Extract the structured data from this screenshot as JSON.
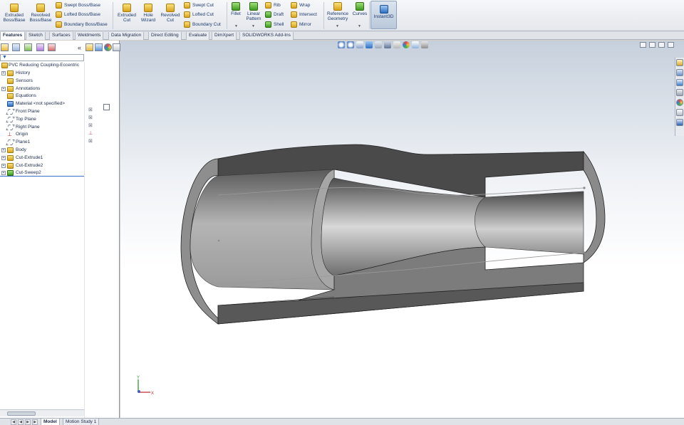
{
  "ribbon": {
    "extruded_boss": [
      "Extruded",
      "Boss/Base"
    ],
    "revolved_boss": [
      "Revolved",
      "Boss/Base"
    ],
    "swept_boss": "Swept Boss/Base",
    "lofted_boss": "Lofted Boss/Base",
    "boundary_boss": "Boundary Boss/Base",
    "extruded_cut": [
      "Extruded",
      "Cut"
    ],
    "hole_wizard": [
      "Hole",
      "Wizard"
    ],
    "revolved_cut": [
      "Revolved",
      "Cut"
    ],
    "swept_cut": "Swept Cut",
    "lofted_cut": "Lofted Cut",
    "boundary_cut": "Boundary Cut",
    "fillet": "Fillet",
    "linear_pattern": [
      "Linear",
      "Pattern"
    ],
    "rib": "Rib",
    "draft": "Draft",
    "shell": "Shell",
    "wrap": "Wrap",
    "intersect": "Intersect",
    "mirror": "Mirror",
    "reference_geometry": [
      "Reference",
      "Geometry"
    ],
    "curves": "Curves",
    "instant3d": "Instant3D"
  },
  "tabs": [
    "Features",
    "Sketch",
    "Surfaces",
    "Weldments",
    "Data Migration",
    "Direct Editing",
    "Evaluate",
    "DimXpert",
    "SOLIDWORKS Add-Ins"
  ],
  "tree": {
    "root": "PVC Reducing Coupling-Eccentric",
    "items": [
      {
        "label": "History",
        "expandable": true
      },
      {
        "label": "Sensors",
        "expandable": false
      },
      {
        "label": "Annotations",
        "expandable": true
      },
      {
        "label": "Equations",
        "expandable": false
      },
      {
        "label": "Material <not specified>",
        "expandable": false
      },
      {
        "label": "Front Plane",
        "expandable": false
      },
      {
        "label": "Top Plane",
        "expandable": false
      },
      {
        "label": "Right Plane",
        "expandable": false
      },
      {
        "label": "Origin",
        "expandable": false
      },
      {
        "label": "Plane1",
        "expandable": false
      },
      {
        "label": "Body",
        "expandable": true
      },
      {
        "label": "Cut-Extrude1",
        "expandable": true
      },
      {
        "label": "Cut-Extrude2",
        "expandable": true
      },
      {
        "label": "Cut-Sweep2",
        "expandable": true
      }
    ]
  },
  "panel": {
    "collapse_symbol": "«"
  },
  "triad": {
    "x": "X",
    "y": "Y"
  },
  "bottom_tabs": [
    "Model",
    "Motion Study 1"
  ],
  "colors": {
    "accent": "#2b6fc2",
    "part_face": "#8d8d8d",
    "part_dark": "#4a4a4a"
  }
}
